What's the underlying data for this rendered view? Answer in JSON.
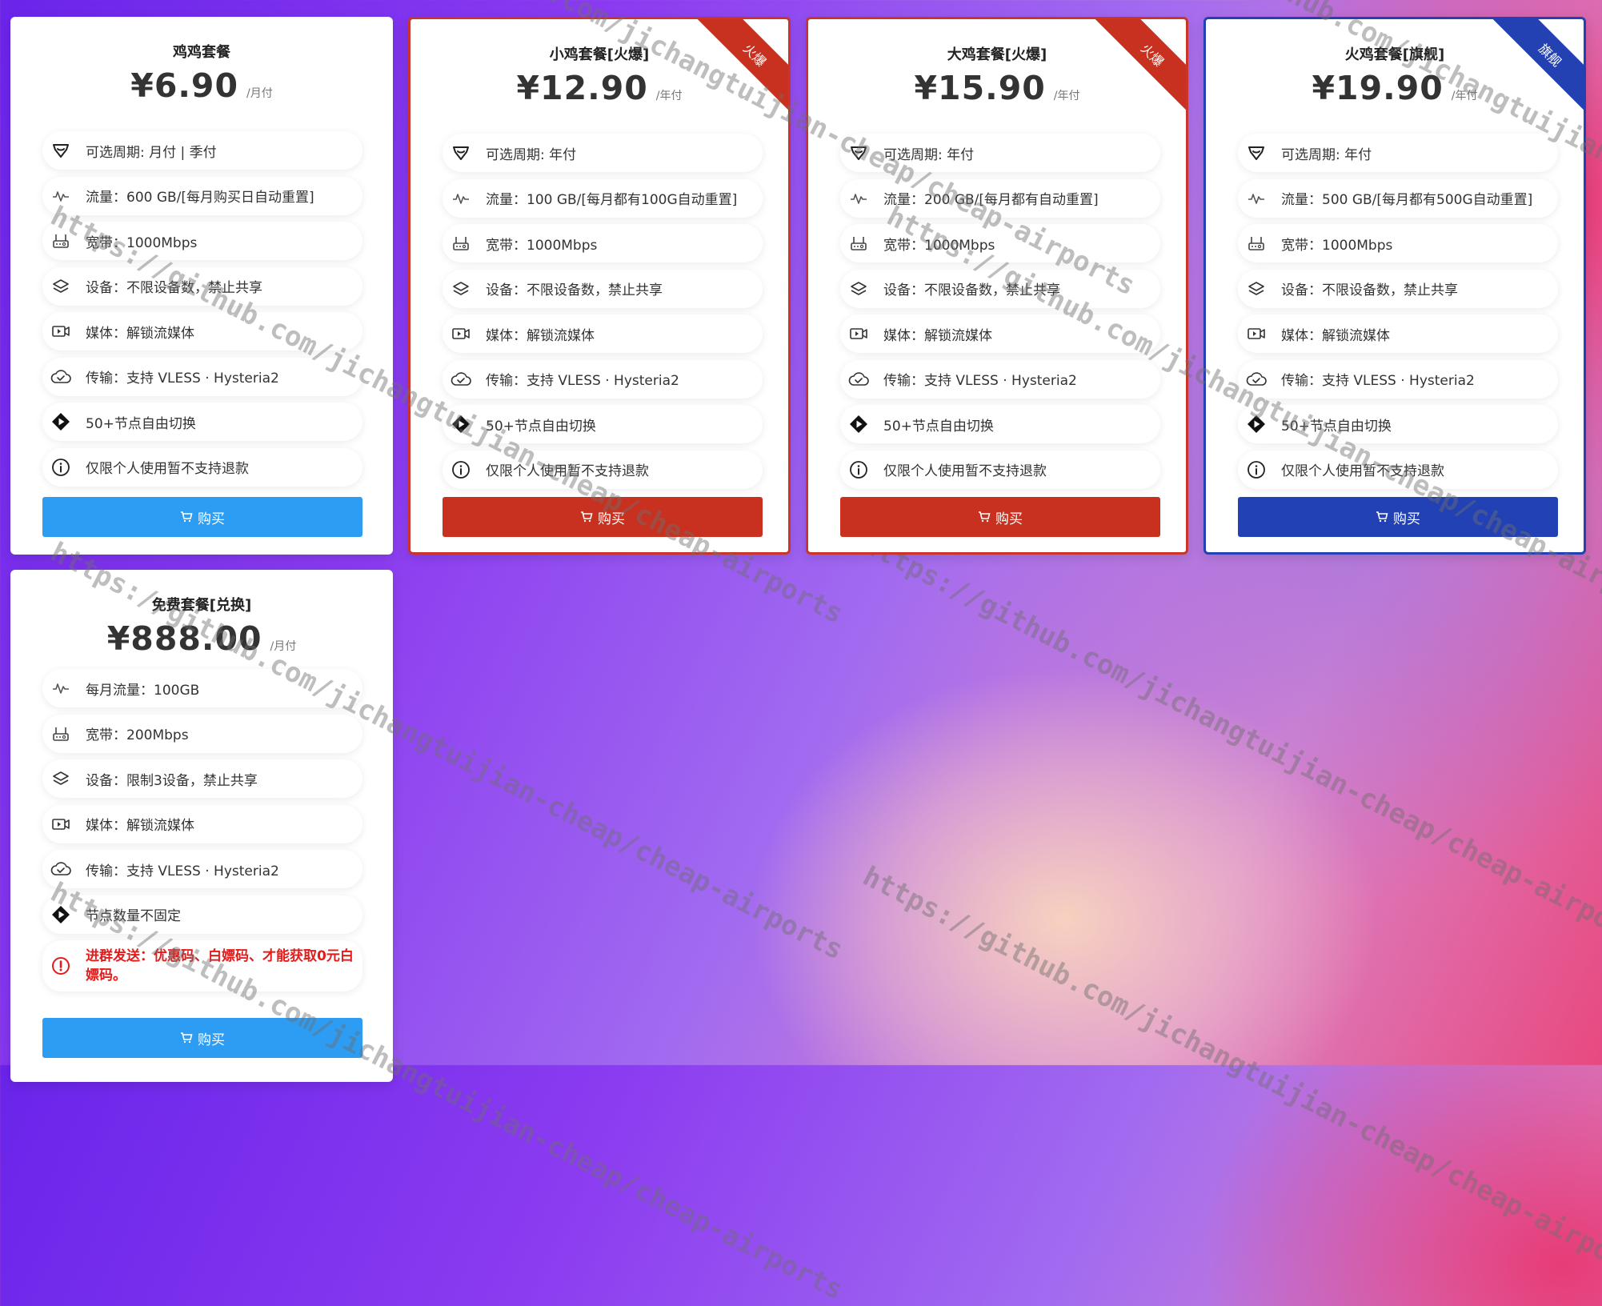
{
  "colors": {
    "sky": "#2d9cf3",
    "red": "#c8311f",
    "navy": "#2241b4",
    "warn": "#e21b1b"
  },
  "plans": [
    {
      "title": "鸡鸡套餐",
      "price": "¥6.90",
      "period": "/月付",
      "buy_label": "购买",
      "features": [
        {
          "icon": "heart-badge-icon",
          "text": "可选周期: 月付 | 季付"
        },
        {
          "icon": "activity-icon",
          "text": "流量：600 GB/[每月购买日自动重置]"
        },
        {
          "icon": "router-icon",
          "text": "宽带：1000Mbps"
        },
        {
          "icon": "layers-icon",
          "text": "设备：不限设备数，禁止共享"
        },
        {
          "icon": "video-icon",
          "text": "媒体：解锁流媒体"
        },
        {
          "icon": "cloud-icon",
          "text": "传输：支持 VLESS · Hysteria2"
        },
        {
          "icon": "play-diamond-icon",
          "text": "50+节点自由切换"
        },
        {
          "icon": "info-icon",
          "text": "仅限个人使用暂不支持退款"
        }
      ]
    },
    {
      "title": "小鸡套餐[火爆]",
      "price": "¥12.90",
      "period": "/年付",
      "buy_label": "购买",
      "ribbon": "火爆",
      "features": [
        {
          "icon": "heart-badge-icon",
          "text": "可选周期: 年付"
        },
        {
          "icon": "activity-icon",
          "text": "流量：100 GB/[每月都有100G自动重置]"
        },
        {
          "icon": "router-icon",
          "text": "宽带：1000Mbps"
        },
        {
          "icon": "layers-icon",
          "text": "设备：不限设备数，禁止共享"
        },
        {
          "icon": "video-icon",
          "text": "媒体：解锁流媒体"
        },
        {
          "icon": "cloud-icon",
          "text": "传输：支持 VLESS · Hysteria2"
        },
        {
          "icon": "play-diamond-icon",
          "text": "50+节点自由切换"
        },
        {
          "icon": "info-icon",
          "text": "仅限个人使用暂不支持退款"
        }
      ]
    },
    {
      "title": "大鸡套餐[火爆]",
      "price": "¥15.90",
      "period": "/年付",
      "buy_label": "购买",
      "ribbon": "火爆",
      "features": [
        {
          "icon": "heart-badge-icon",
          "text": "可选周期: 年付"
        },
        {
          "icon": "activity-icon",
          "text": "流量：200 GB/[每月都有自动重置]"
        },
        {
          "icon": "router-icon",
          "text": "宽带：1000Mbps"
        },
        {
          "icon": "layers-icon",
          "text": "设备：不限设备数，禁止共享"
        },
        {
          "icon": "video-icon",
          "text": "媒体：解锁流媒体"
        },
        {
          "icon": "cloud-icon",
          "text": "传输：支持 VLESS · Hysteria2"
        },
        {
          "icon": "play-diamond-icon",
          "text": "50+节点自由切换"
        },
        {
          "icon": "info-icon",
          "text": "仅限个人使用暂不支持退款"
        }
      ]
    },
    {
      "title": "火鸡套餐[旗舰]",
      "price": "¥19.90",
      "period": "/年付",
      "buy_label": "购买",
      "ribbon": "旗舰",
      "features": [
        {
          "icon": "heart-badge-icon",
          "text": "可选周期: 年付"
        },
        {
          "icon": "activity-icon",
          "text": "流量：500 GB/[每月都有500G自动重置]"
        },
        {
          "icon": "router-icon",
          "text": "宽带：1000Mbps"
        },
        {
          "icon": "layers-icon",
          "text": "设备：不限设备数，禁止共享"
        },
        {
          "icon": "video-icon",
          "text": "媒体：解锁流媒体"
        },
        {
          "icon": "cloud-icon",
          "text": "传输：支持 VLESS · Hysteria2"
        },
        {
          "icon": "play-diamond-icon",
          "text": "50+节点自由切换"
        },
        {
          "icon": "info-icon",
          "text": "仅限个人使用暂不支持退款"
        }
      ]
    },
    {
      "title": "免费套餐[兑换]",
      "price": "¥888.00",
      "period": "/月付",
      "buy_label": "购买",
      "features": [
        {
          "icon": "activity-icon",
          "text": "每月流量：100GB"
        },
        {
          "icon": "router-icon",
          "text": "宽带：200Mbps"
        },
        {
          "icon": "layers-icon",
          "text": "设备：限制3设备，禁止共享"
        },
        {
          "icon": "video-icon",
          "text": "媒体：解锁流媒体"
        },
        {
          "icon": "cloud-icon",
          "text": "传输：支持 VLESS · Hysteria2"
        },
        {
          "icon": "play-diamond-icon",
          "text": "节点数量不固定"
        },
        {
          "icon": "alert-circle-icon",
          "text": "进群发送：优惠码、白嫖码、才能获取0元白嫖码。"
        }
      ]
    }
  ],
  "watermark": "https://github.com/jichangtuijian-cheap/cheap-airports"
}
